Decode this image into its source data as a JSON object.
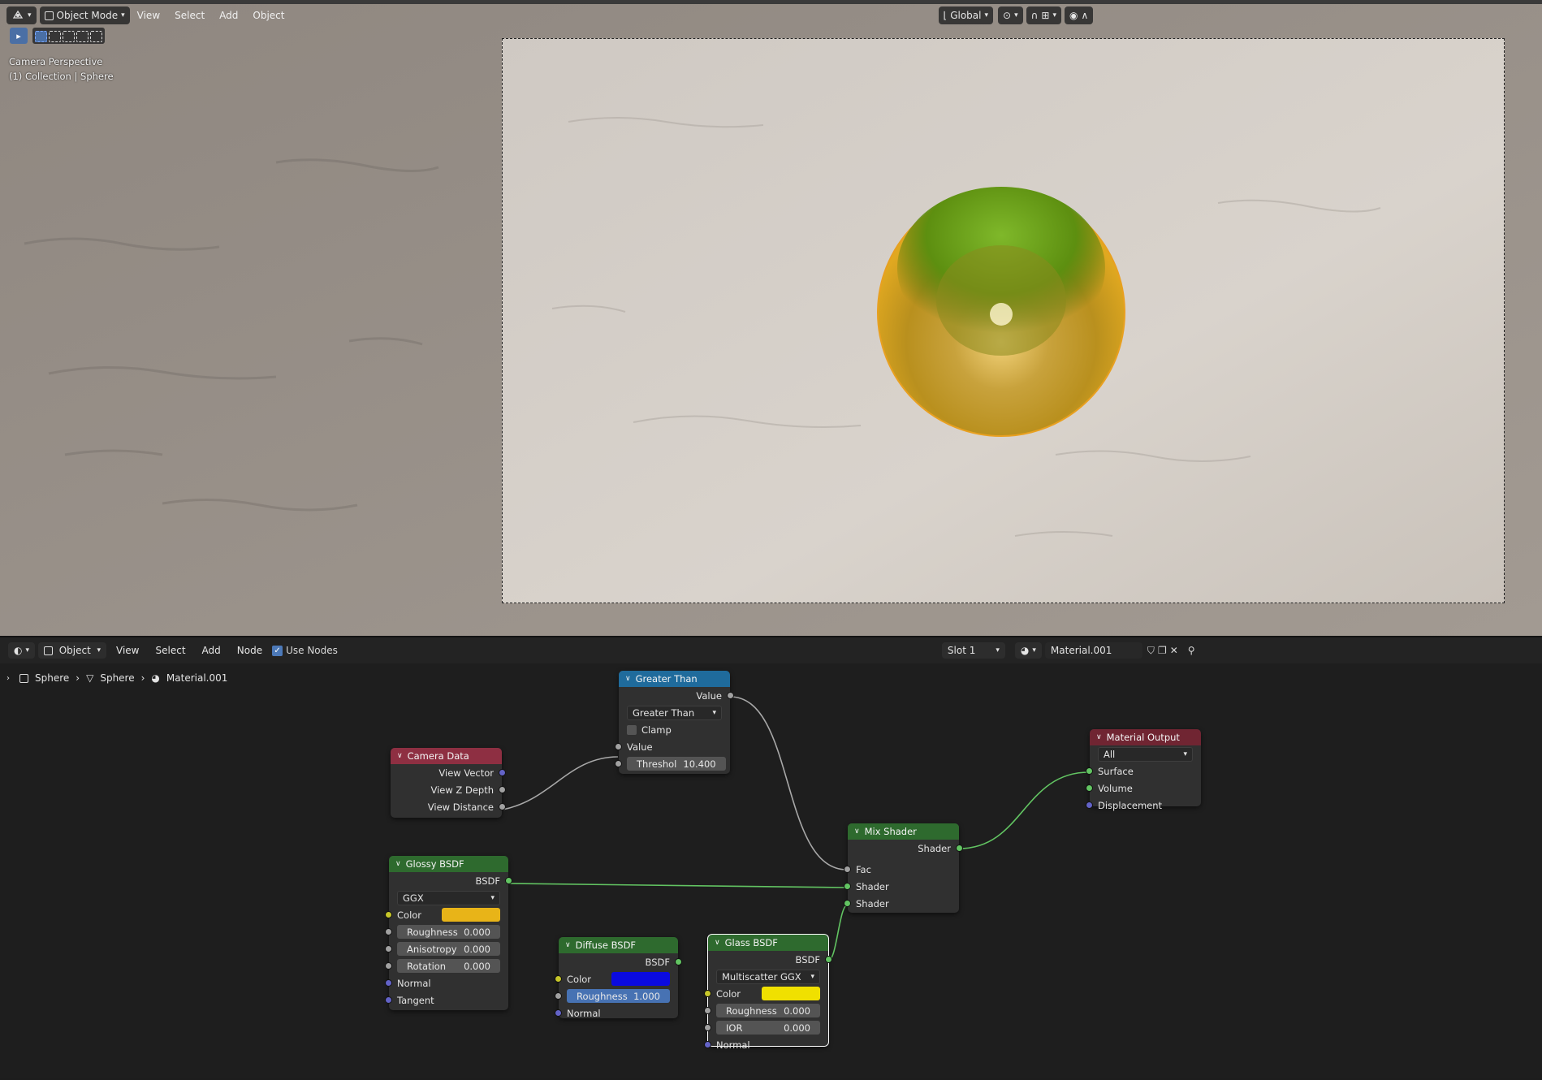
{
  "viewport": {
    "editor_type_icon": "3d-viewport-icon",
    "mode": "Object Mode",
    "menus": [
      "View",
      "Select",
      "Add",
      "Object"
    ],
    "transform_orientation": "Global",
    "info_line1": "Camera Perspective",
    "info_line2": "(1) Collection | Sphere"
  },
  "node_editor": {
    "object_type": "Object",
    "menus": [
      "View",
      "Select",
      "Add",
      "Node"
    ],
    "use_nodes_label": "Use Nodes",
    "slot": "Slot 1",
    "material_name": "Material.001",
    "breadcrumb": [
      "Sphere",
      "Sphere",
      "Material.001"
    ]
  },
  "nodes": {
    "greater_than": {
      "title": "Greater Than",
      "out_value": "Value",
      "operation": "Greater Than",
      "clamp": "Clamp",
      "in_value": "Value",
      "threshold_label": "Threshol",
      "threshold_value": "10.400"
    },
    "camera_data": {
      "title": "Camera Data",
      "view_vector": "View Vector",
      "view_z_depth": "View Z Depth",
      "view_distance": "View Distance"
    },
    "material_output": {
      "title": "Material Output",
      "target": "All",
      "surface": "Surface",
      "volume": "Volume",
      "displacement": "Displacement"
    },
    "mix_shader": {
      "title": "Mix Shader",
      "out": "Shader",
      "fac": "Fac",
      "shader1": "Shader",
      "shader2": "Shader"
    },
    "glossy": {
      "title": "Glossy BSDF",
      "out": "BSDF",
      "distribution": "GGX",
      "color_label": "Color",
      "color": "#e8b418",
      "roughness_label": "Roughness",
      "roughness": "0.000",
      "anisotropy_label": "Anisotropy",
      "anisotropy": "0.000",
      "rotation_label": "Rotation",
      "rotation": "0.000",
      "normal": "Normal",
      "tangent": "Tangent"
    },
    "diffuse": {
      "title": "Diffuse BSDF",
      "out": "BSDF",
      "color_label": "Color",
      "color": "#0a0ae0",
      "roughness_label": "Roughness",
      "roughness": "1.000",
      "normal": "Normal"
    },
    "glass": {
      "title": "Glass BSDF",
      "out": "BSDF",
      "distribution": "Multiscatter GGX",
      "color_label": "Color",
      "color": "#f0e000",
      "roughness_label": "Roughness",
      "roughness": "0.000",
      "ior_label": "IOR",
      "ior": "0.000",
      "normal": "Normal"
    }
  }
}
